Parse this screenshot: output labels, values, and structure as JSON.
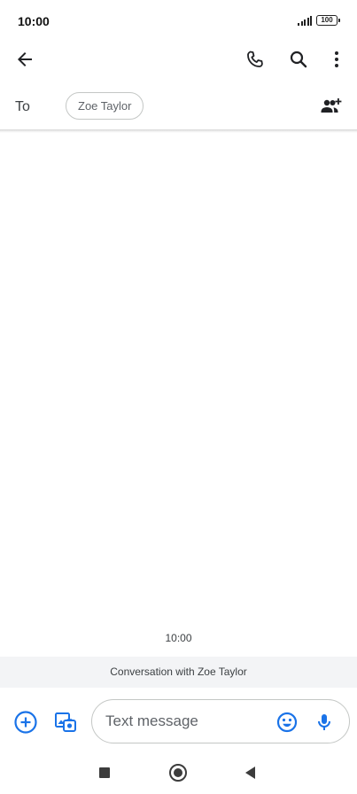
{
  "status_bar": {
    "time": "10:00",
    "battery": "100",
    "icons": [
      "signal-icon",
      "battery-icon"
    ]
  },
  "app_bar": {
    "icons": [
      "back-arrow-icon",
      "phone-icon",
      "search-icon",
      "more-vert-icon"
    ]
  },
  "recipients": {
    "to_label": "To",
    "chips": [
      "Zoe Taylor"
    ],
    "icons": [
      "add-people-icon"
    ]
  },
  "conversation": {
    "timestamp": "10:00",
    "banner": "Conversation with Zoe Taylor"
  },
  "compose": {
    "placeholder": "Text message",
    "value": "",
    "icons": [
      "add-circle-icon",
      "gallery-icon",
      "emoji-icon",
      "mic-icon"
    ]
  },
  "navigation": {
    "icons": [
      "recents-icon",
      "home-icon",
      "back-icon"
    ]
  },
  "colors": {
    "accent": "#1a73e8",
    "icon": "#202124",
    "banner_bg": "#f3f4f6"
  }
}
